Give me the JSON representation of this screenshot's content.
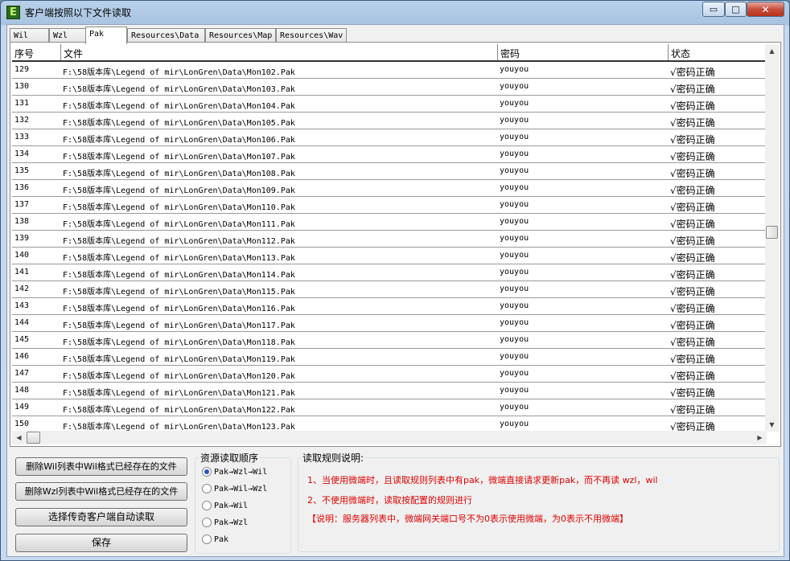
{
  "window": {
    "title": "客户端按照以下文件读取",
    "icon_letter": "E",
    "minimize_glyph": "▭",
    "maximize_glyph": "□",
    "close_glyph": "✕"
  },
  "tabs": [
    {
      "label": "Wil",
      "active": false
    },
    {
      "label": "Wzl",
      "active": false
    },
    {
      "label": "Pak",
      "active": true
    },
    {
      "label": "Resources\\Data",
      "active": false
    },
    {
      "label": "Resources\\Map",
      "active": false
    },
    {
      "label": "Resources\\Wav",
      "active": false
    }
  ],
  "table": {
    "columns": [
      "序号",
      "文件",
      "密码",
      "状态"
    ],
    "rows": [
      {
        "seq": "129",
        "file": "F:\\58版本库\\Legend of mir\\LonGren\\Data\\Mon102.Pak",
        "password": "youyou",
        "status": "√密码正确"
      },
      {
        "seq": "130",
        "file": "F:\\58版本库\\Legend of mir\\LonGren\\Data\\Mon103.Pak",
        "password": "youyou",
        "status": "√密码正确"
      },
      {
        "seq": "131",
        "file": "F:\\58版本库\\Legend of mir\\LonGren\\Data\\Mon104.Pak",
        "password": "youyou",
        "status": "√密码正确"
      },
      {
        "seq": "132",
        "file": "F:\\58版本库\\Legend of mir\\LonGren\\Data\\Mon105.Pak",
        "password": "youyou",
        "status": "√密码正确"
      },
      {
        "seq": "133",
        "file": "F:\\58版本库\\Legend of mir\\LonGren\\Data\\Mon106.Pak",
        "password": "youyou",
        "status": "√密码正确"
      },
      {
        "seq": "134",
        "file": "F:\\58版本库\\Legend of mir\\LonGren\\Data\\Mon107.Pak",
        "password": "youyou",
        "status": "√密码正确"
      },
      {
        "seq": "135",
        "file": "F:\\58版本库\\Legend of mir\\LonGren\\Data\\Mon108.Pak",
        "password": "youyou",
        "status": "√密码正确"
      },
      {
        "seq": "136",
        "file": "F:\\58版本库\\Legend of mir\\LonGren\\Data\\Mon109.Pak",
        "password": "youyou",
        "status": "√密码正确"
      },
      {
        "seq": "137",
        "file": "F:\\58版本库\\Legend of mir\\LonGren\\Data\\Mon110.Pak",
        "password": "youyou",
        "status": "√密码正确"
      },
      {
        "seq": "138",
        "file": "F:\\58版本库\\Legend of mir\\LonGren\\Data\\Mon111.Pak",
        "password": "youyou",
        "status": "√密码正确"
      },
      {
        "seq": "139",
        "file": "F:\\58版本库\\Legend of mir\\LonGren\\Data\\Mon112.Pak",
        "password": "youyou",
        "status": "√密码正确"
      },
      {
        "seq": "140",
        "file": "F:\\58版本库\\Legend of mir\\LonGren\\Data\\Mon113.Pak",
        "password": "youyou",
        "status": "√密码正确"
      },
      {
        "seq": "141",
        "file": "F:\\58版本库\\Legend of mir\\LonGren\\Data\\Mon114.Pak",
        "password": "youyou",
        "status": "√密码正确"
      },
      {
        "seq": "142",
        "file": "F:\\58版本库\\Legend of mir\\LonGren\\Data\\Mon115.Pak",
        "password": "youyou",
        "status": "√密码正确"
      },
      {
        "seq": "143",
        "file": "F:\\58版本库\\Legend of mir\\LonGren\\Data\\Mon116.Pak",
        "password": "youyou",
        "status": "√密码正确"
      },
      {
        "seq": "144",
        "file": "F:\\58版本库\\Legend of mir\\LonGren\\Data\\Mon117.Pak",
        "password": "youyou",
        "status": "√密码正确"
      },
      {
        "seq": "145",
        "file": "F:\\58版本库\\Legend of mir\\LonGren\\Data\\Mon118.Pak",
        "password": "youyou",
        "status": "√密码正确"
      },
      {
        "seq": "146",
        "file": "F:\\58版本库\\Legend of mir\\LonGren\\Data\\Mon119.Pak",
        "password": "youyou",
        "status": "√密码正确"
      },
      {
        "seq": "147",
        "file": "F:\\58版本库\\Legend of mir\\LonGren\\Data\\Mon120.Pak",
        "password": "youyou",
        "status": "√密码正确"
      },
      {
        "seq": "148",
        "file": "F:\\58版本库\\Legend of mir\\LonGren\\Data\\Mon121.Pak",
        "password": "youyou",
        "status": "√密码正确"
      },
      {
        "seq": "149",
        "file": "F:\\58版本库\\Legend of mir\\LonGren\\Data\\Mon122.Pak",
        "password": "youyou",
        "status": "√密码正确"
      },
      {
        "seq": "150",
        "file": "F:\\58版本库\\Legend of mir\\LonGren\\Data\\Mon123.Pak",
        "password": "youyou",
        "status": "√密码正确"
      }
    ]
  },
  "scroll": {
    "up": "▲",
    "down": "▼",
    "left": "◀",
    "right": "▶"
  },
  "buttons": {
    "delete_wil": "删除Wil列表中Wil格式已经存在的文件",
    "delete_wzl": "删除Wzl列表中Wil格式已经存在的文件",
    "select_client": "选择传奇客户端自动读取",
    "save": "保存"
  },
  "read_order": {
    "title": "资源读取顺序",
    "selected": "Pak→Wzl→Wil",
    "options": [
      "Pak→Wzl→Wil",
      "Pak→Wil→Wzl",
      "Pak→Wil",
      "Pak→Wzl",
      "Pak"
    ]
  },
  "rules": {
    "title": "读取规则说明:",
    "line1": "1、当使用微端时，且读取规则列表中有pak，微端直接请求更新pak，而不再读 wzl，wil",
    "line2": "2、不使用微端时，读取按配置的规则进行",
    "line3": "【说明：服务器列表中，微端网关端口号不为0表示使用微端，为0表示不用微端】",
    "color": "#e00000"
  }
}
